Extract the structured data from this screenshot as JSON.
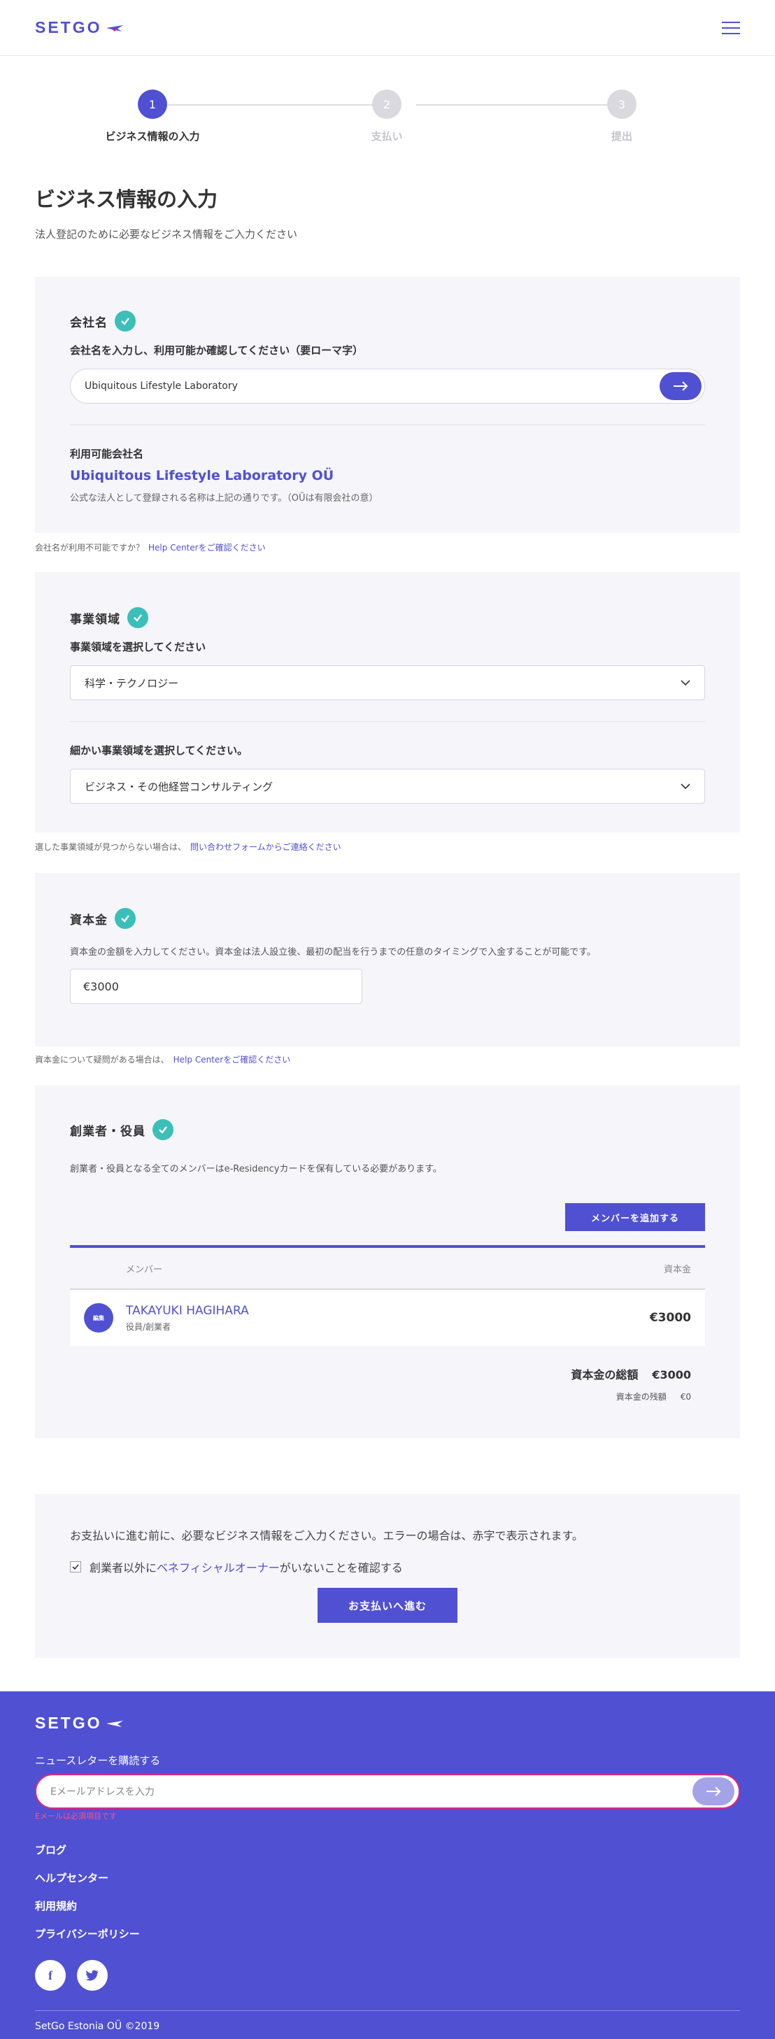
{
  "header": {
    "logo": "SETGO",
    "menu_icon": "hamburger-icon"
  },
  "steps": [
    {
      "number": "1",
      "label": "ビジネス情報の入力",
      "active": true
    },
    {
      "number": "2",
      "label": "支払い",
      "active": false
    },
    {
      "number": "3",
      "label": "提出",
      "active": false
    }
  ],
  "page": {
    "title": "ビジネス情報の入力",
    "subtitle": "法人登記のために必要なビジネス情報をご入力ください"
  },
  "company": {
    "title": "会社名",
    "label": "会社名を入力し、利用可能か確認してください（要ローマ字）",
    "value": "Ubiquitous Lifestyle Laboratory",
    "result_label": "利用可能会社名",
    "result_name": "Ubiquitous Lifestyle Laboratory OÜ",
    "result_note": "公式な法人として登録される名称は上記の通りです。（OÜは有限会社の意）",
    "help_text": "会社名が利用不可能ですか？",
    "help_link": "Help Centerをご確認ください"
  },
  "business": {
    "title": "事業領域",
    "label": "事業領域を選択してください",
    "selected": "科学・テクノロジー",
    "sub_label": "細かい事業領域を選択してください。",
    "sub_selected": "ビジネス・その他経営コンサルティング",
    "help_text": "選した事業領域が見つからない場合は、",
    "help_link": "問い合わせフォームからご連絡ください"
  },
  "capital": {
    "title": "資本金",
    "desc": "資本金の金額を入力してください。資本金は法人設立後、最初の配当を行うまでの任意のタイミングで入金することが可能です。",
    "value": "€3000",
    "help_text": "資本金について疑問がある場合は、",
    "help_link": "Help Centerをご確認ください"
  },
  "founders": {
    "title": "創業者・役員",
    "desc": "創業者・役員となる全てのメンバーはe-Residencyカードを保有している必要があります。",
    "add_button": "メンバーを追加する",
    "col_member": "メンバー",
    "col_capital": "資本金",
    "rows": [
      {
        "avatar": "編集",
        "name": "TAKAYUKI HAGIHARA",
        "role": "役員/創業者",
        "capital": "€3000"
      }
    ],
    "total_label": "資本金の総額",
    "total_value": "€3000",
    "remain_label": "資本金の残額",
    "remain_value": "€0"
  },
  "confirm": {
    "text": "お支払いに進む前に、必要なビジネス情報をご入力ください。エラーの場合は、赤字で表示されます。",
    "check_prefix": "創業者以外に",
    "check_link": "ベネフィシャルオーナー",
    "check_suffix": "がいないことを確認する",
    "pay_button": "お支払いへ進む"
  },
  "footer": {
    "logo": "SETGO",
    "newsletter_title": "ニュースレターを購読する",
    "email_placeholder": "Eメールアドレスを入力",
    "email_error": "Eメールは必須項目です",
    "links": [
      "ブログ",
      "ヘルプセンター",
      "利用規約",
      "プライバシーポリシー"
    ],
    "copyright": "SetGo Estonia OÜ ©2019"
  },
  "colors": {
    "brand": "#5050d3",
    "teal": "#3bbfb8",
    "error": "#e0287a"
  }
}
